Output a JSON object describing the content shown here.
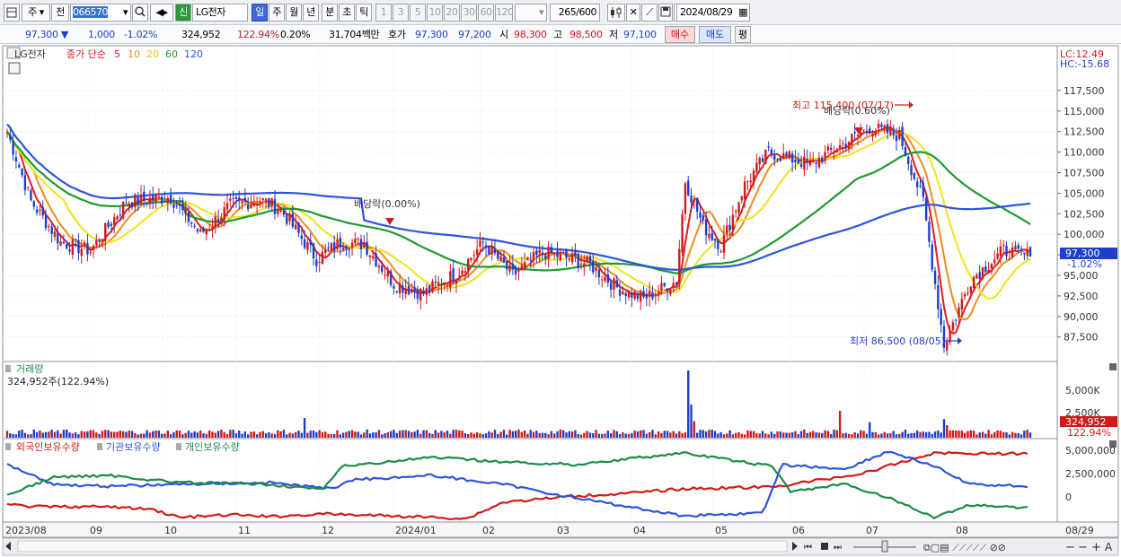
{
  "toolbar": {
    "mode_label": "주",
    "prev_label": "전",
    "stock_code": "066570",
    "stock_name": "LG전자",
    "badge": "신",
    "periods": [
      "일",
      "주",
      "월",
      "년",
      "분",
      "초",
      "틱"
    ],
    "selected_period": "일",
    "intervals": [
      "1",
      "3",
      "5",
      "10",
      "20",
      "30",
      "60",
      "120"
    ],
    "count_display": "265",
    "count_max": "/600",
    "date": "2024/08/29"
  },
  "quote": {
    "price": "97,300",
    "change": "1,000",
    "change_pct": "-1.02%",
    "volume": "324,952",
    "volume_ratio": "122.94%",
    "turnover_pct": "0.20%",
    "trade_value": "31,704백만",
    "bid_label": "호가",
    "ask_price": "97,300",
    "bid_price": "97,200",
    "open_label": "시",
    "open": "98,300",
    "high_label": "고",
    "high": "98,500",
    "low_label": "저",
    "low": "97,100",
    "buy_btn": "매수",
    "sell_btn": "매도",
    "eval_btn": "평"
  },
  "price_panel": {
    "stock_tag": "LG전자",
    "ma_title": "종가 단순",
    "ma_periods": [
      "5",
      "10",
      "20",
      "60",
      "120"
    ],
    "ma_colors": [
      "#e01e1e",
      "#f08c1e",
      "#f2e21a",
      "#1f9a2f",
      "#2f54dc"
    ],
    "lc": "LC:12.49",
    "hc": "HC:-15.68",
    "current_price_tag": "97,300",
    "current_change_tag": "-1.02%",
    "high_annotation": "최고 115,400 (07/17)",
    "low_annotation": "최저 86,500 (08/05)",
    "div_annotation_1": "배당락(0.00%)",
    "div_annotation_2": "배당락(0.60%)",
    "y_ticks": [
      "117,500",
      "115,000",
      "112,500",
      "110,000",
      "107,500",
      "105,000",
      "102,500",
      "100,000",
      "97,500",
      "95,000",
      "92,500",
      "90,000",
      "87,500"
    ]
  },
  "volume_panel": {
    "title": "거래량",
    "value": "324,952주(122.94%)",
    "y_ticks": [
      "5,000K",
      "2,500K"
    ],
    "current_tag": "324,952",
    "ratio_tag": "122.94%"
  },
  "holdings_panel": {
    "legend": [
      "외국인보유수량",
      "기관보유수량",
      "개인보유수량"
    ],
    "colors": [
      "#d11a1a",
      "#2f54dc",
      "#1f8a4a"
    ],
    "y_ticks": [
      "5,000,000",
      "2,500,000",
      "0"
    ]
  },
  "x_axis": {
    "labels": [
      "2023/08",
      "09",
      "10",
      "11",
      "12",
      "2024/01",
      "02",
      "03",
      "04",
      "05",
      "06",
      "07",
      "08"
    ],
    "right_label": "08/29"
  },
  "chart_data": {
    "type": "candlestick",
    "title": "LG전자",
    "y_range": [
      85500,
      120000
    ],
    "high": {
      "value": 115400,
      "date": "07/17"
    },
    "low": {
      "value": 86500,
      "date": "08/05"
    },
    "last_close": 97300,
    "volume_last": 324952,
    "volume_max_k": 6500,
    "series": [
      {
        "name": "종가 단순 5",
        "color": "#e01e1e"
      },
      {
        "name": "10",
        "color": "#f08c1e"
      },
      {
        "name": "20",
        "color": "#f2e21a"
      },
      {
        "name": "60",
        "color": "#1f9a2f"
      },
      {
        "name": "120",
        "color": "#2f54dc"
      }
    ]
  }
}
